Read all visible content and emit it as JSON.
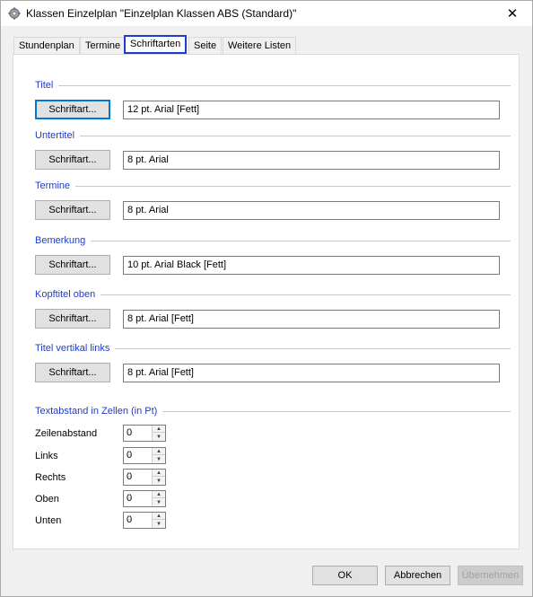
{
  "window": {
    "title": "Klassen Einzelplan \"Einzelplan Klassen ABS (Standard)\"",
    "close_symbol": "✕"
  },
  "tabs": [
    {
      "label": "Stundenplan",
      "active": false
    },
    {
      "label": "Termine",
      "active": false
    },
    {
      "label": "Schriftarten",
      "active": true
    },
    {
      "label": "Seite",
      "active": false
    },
    {
      "label": "Weitere Listen",
      "active": false
    }
  ],
  "font_groups": [
    {
      "title": "Titel",
      "button": "Schriftart...",
      "value": "12 pt. Arial  [Fett]"
    },
    {
      "title": "Untertitel",
      "button": "Schriftart...",
      "value": "8 pt. Arial"
    },
    {
      "title": "Termine",
      "button": "Schriftart...",
      "value": "8 pt. Arial"
    },
    {
      "title": "Bemerkung",
      "button": "Schriftart...",
      "value": "10 pt. Arial Black  [Fett]"
    },
    {
      "title": "Kopftitel oben",
      "button": "Schriftart...",
      "value": "8 pt. Arial  [Fett]"
    },
    {
      "title": "Titel vertikal links",
      "button": "Schriftart...",
      "value": "8 pt. Arial  [Fett]"
    }
  ],
  "spacing": {
    "title": "Textabstand in Zellen (in Pt)",
    "fields": [
      {
        "label": "Zeilenabstand",
        "value": "0"
      },
      {
        "label": "Links",
        "value": "0"
      },
      {
        "label": "Rechts",
        "value": "0"
      },
      {
        "label": "Oben",
        "value": "0"
      },
      {
        "label": "Unten",
        "value": "0"
      }
    ]
  },
  "footer": {
    "ok": "OK",
    "cancel": "Abbrechen",
    "apply": "Übernehmen"
  },
  "colors": {
    "group_title": "#1f3cc8",
    "active_tab_border": "#1e3cd2"
  },
  "icons": {
    "app": "gear-icon",
    "spin_up": "▲",
    "spin_down": "▼"
  }
}
